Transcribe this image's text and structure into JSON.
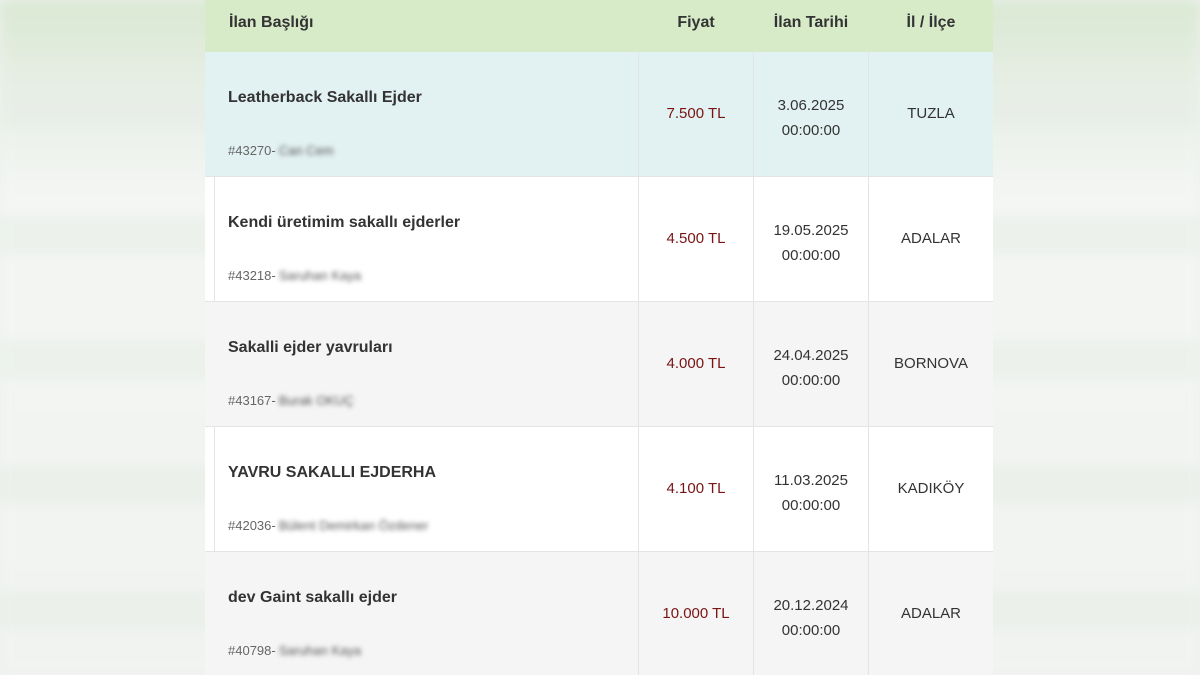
{
  "table": {
    "headers": {
      "title": "İlan Başlığı",
      "price": "Fiyat",
      "date": "İlan Tarihi",
      "location": "İl / İlçe"
    },
    "rows": [
      {
        "title": "Leatherback Sakallı Ejder",
        "id": "#43270-",
        "seller": "Can Cem",
        "price": "7.500 TL",
        "date": "3.06.2025",
        "time": "00:00:00",
        "location": "TUZLA"
      },
      {
        "title": "Kendi üretimim sakallı ejderler",
        "id": "#43218-",
        "seller": "Saruhan Kaya",
        "price": "4.500 TL",
        "date": "19.05.2025",
        "time": "00:00:00",
        "location": "ADALAR"
      },
      {
        "title": "Sakalli ejder yavruları",
        "id": "#43167-",
        "seller": "Burak OKUÇ",
        "price": "4.000 TL",
        "date": "24.04.2025",
        "time": "00:00:00",
        "location": "BORNOVA"
      },
      {
        "title": "YAVRU SAKALLI EJDERHA",
        "id": "#42036-",
        "seller": "Bülent Demirkan Özdener",
        "price": "4.100 TL",
        "date": "11.03.2025",
        "time": "00:00:00",
        "location": "KADIKÖY"
      },
      {
        "title": "dev Gaint sakallı ejder",
        "id": "#40798-",
        "seller": "Saruhan Kaya",
        "price": "10.000 TL",
        "date": "20.12.2024",
        "time": "00:00:00",
        "location": "ADALAR"
      }
    ]
  },
  "colors": {
    "header_bg": "#d7ebc9",
    "highlight_row_bg": "#e2f1f1",
    "price_text": "#7a1414"
  }
}
